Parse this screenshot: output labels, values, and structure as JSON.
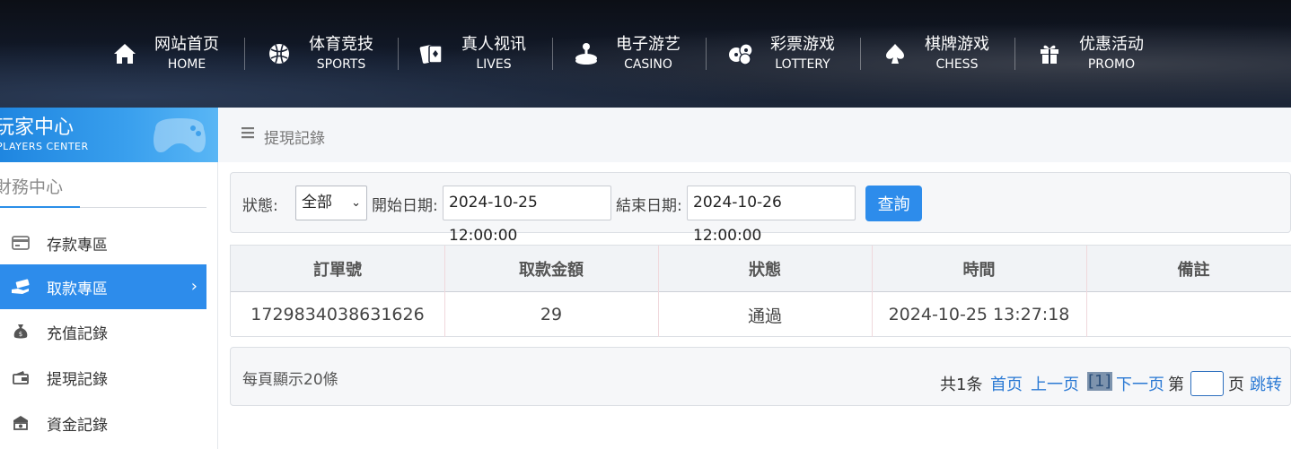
{
  "nav": [
    {
      "cn": "网站首页",
      "en": "HOME",
      "icon": "home-icon"
    },
    {
      "cn": "体育竞技",
      "en": "SPORTS",
      "icon": "ball-icon"
    },
    {
      "cn": "真人视讯",
      "en": "LIVES",
      "icon": "cards-icon"
    },
    {
      "cn": "电子游艺",
      "en": "CASINO",
      "icon": "joystick-icon"
    },
    {
      "cn": "彩票游戏",
      "en": "LOTTERY",
      "icon": "lottery-balls-icon"
    },
    {
      "cn": "棋牌游戏",
      "en": "CHESS",
      "icon": "spade-icon"
    },
    {
      "cn": "优惠活动",
      "en": "PROMO",
      "icon": "gift-icon"
    }
  ],
  "sidebar": {
    "banner_cn": "玩家中心",
    "banner_en": "PLAYERS CENTER",
    "section": "財務中心",
    "items": [
      {
        "label": "存款專區",
        "icon": "card-icon",
        "active": false
      },
      {
        "label": "取款專區",
        "icon": "hand-cash-icon",
        "active": true
      },
      {
        "label": "充值記錄",
        "icon": "money-bag-icon",
        "active": false
      },
      {
        "label": "提現記錄",
        "icon": "wallet-icon",
        "active": false
      },
      {
        "label": "資金記錄",
        "icon": "safe-icon",
        "active": false
      }
    ]
  },
  "breadcrumb": {
    "title": "提現記錄",
    "icon": "menu-icon"
  },
  "filter": {
    "status_label": "狀態:",
    "status_value": "全部",
    "start_label": "開始日期:",
    "start_value": "2024-10-25 12:00:00",
    "end_label": "結束日期:",
    "end_value": "2024-10-26 12:00:00",
    "query_label": "查詢"
  },
  "table": {
    "headers": [
      "訂單號",
      "取款金額",
      "狀態",
      "時間",
      "備註"
    ],
    "rows": [
      [
        "1729834038631626",
        "29",
        "通過",
        "2024-10-25 13:27:18",
        ""
      ]
    ]
  },
  "pager": {
    "per_page": "每頁顯示20條",
    "total": "共1条",
    "first": "首页",
    "prev": "上一页",
    "current": "[1]",
    "next": "下一页",
    "goto_prefix": "第",
    "goto_suffix": "页",
    "goto_btn": "跳转"
  },
  "colors": {
    "accent": "#2d8ceb",
    "link": "#2a79d4"
  }
}
